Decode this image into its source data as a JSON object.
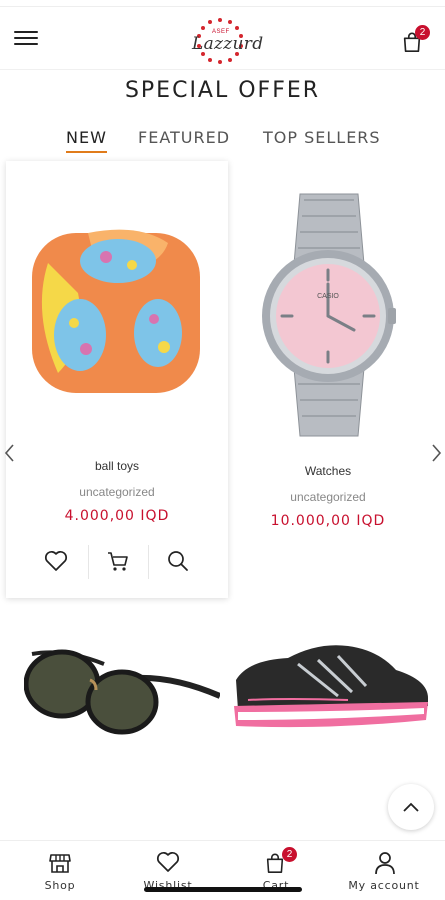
{
  "header": {
    "logo_small": "ASEF",
    "logo_text": "Lazzurd",
    "cart_count": "2"
  },
  "section": {
    "title": "SPECIAL OFFER"
  },
  "tabs": [
    {
      "label": "NEW",
      "active": true
    },
    {
      "label": "FEATURED",
      "active": false
    },
    {
      "label": "TOP SELLERS",
      "active": false
    }
  ],
  "products": [
    {
      "name": "ball toys",
      "category": "uncategorized",
      "price": "4.000,00 IQD",
      "image": "ball-toy"
    },
    {
      "name": "Watches",
      "category": "uncategorized",
      "price": "10.000,00 IQD",
      "image": "pink-watch",
      "watch_brand": "CASIO"
    },
    {
      "image": "sunglasses"
    },
    {
      "image": "running-shoe"
    }
  ],
  "bottom_nav": [
    {
      "label": "Shop",
      "icon": "shop-icon"
    },
    {
      "label": "Wishlist",
      "icon": "heart-icon"
    },
    {
      "label": "Cart",
      "icon": "shopping-bag-icon",
      "badge": "2"
    },
    {
      "label": "My account",
      "icon": "user-icon"
    }
  ],
  "colors": {
    "accent_red": "#c8102e",
    "tab_underline": "#e07b1a",
    "text": "#222222"
  }
}
